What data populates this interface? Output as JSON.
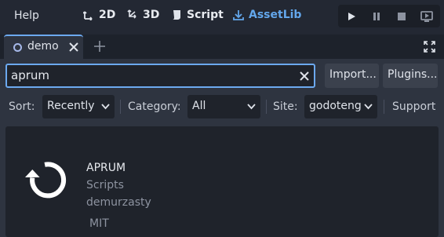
{
  "menu": {
    "help_label": "Help"
  },
  "workspaces": {
    "two_d": "2D",
    "three_d": "3D",
    "script": "Script",
    "assetlib": "AssetLib"
  },
  "tab": {
    "label": "demo"
  },
  "search": {
    "value": "aprum"
  },
  "buttons": {
    "import_label": "Import...",
    "plugins_label": "Plugins..."
  },
  "filters": {
    "sort_label": "Sort:",
    "sort_value": "Recently",
    "category_label": "Category:",
    "category_value": "All",
    "site_label": "Site:",
    "site_value": "godoteng",
    "support_label": "Support"
  },
  "asset": {
    "name": "APRUM",
    "category": "Scripts",
    "author": "demurzasty",
    "license": "MIT",
    "icon": "reload-icon"
  },
  "colors": {
    "accent": "#63a7ec",
    "background": "#232833",
    "panel": "#2e3440",
    "field": "#1f232b"
  }
}
